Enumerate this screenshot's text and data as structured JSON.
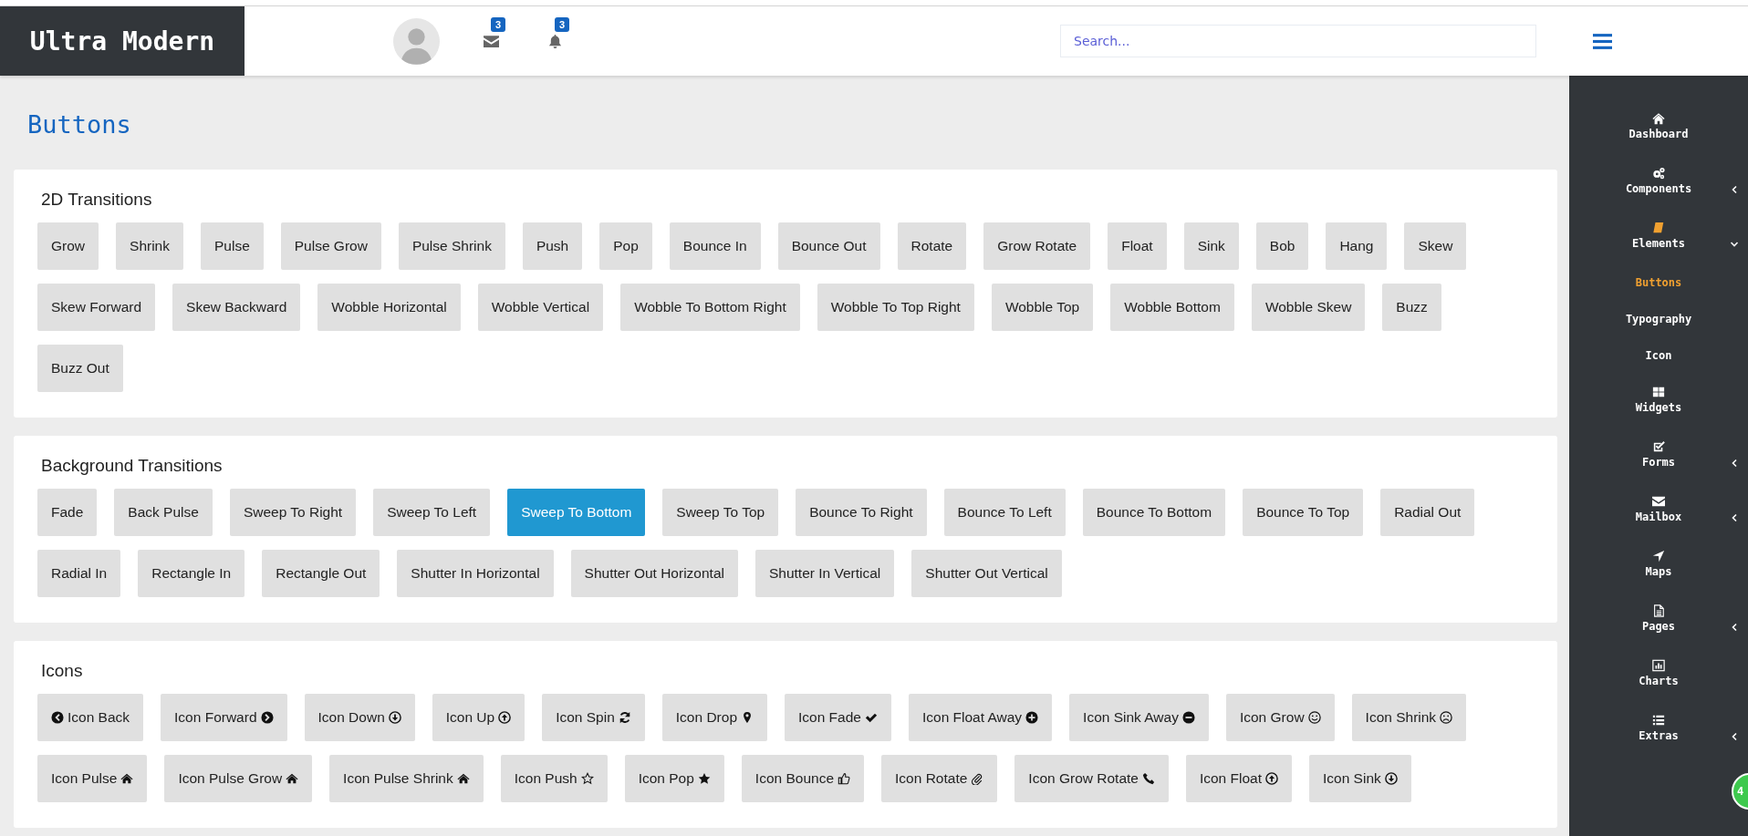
{
  "header": {
    "logo": "Ultra Modern",
    "messages_badge": "3",
    "notifications_badge": "3",
    "search": {
      "placeholder": "Search..."
    }
  },
  "page_title": "Buttons",
  "sections": [
    {
      "title": "2D Transitions",
      "buttons": [
        {
          "label": "Grow",
          "selected": false
        },
        {
          "label": "Shrink",
          "selected": false
        },
        {
          "label": "Pulse",
          "selected": false
        },
        {
          "label": "Pulse Grow",
          "selected": false
        },
        {
          "label": "Pulse Shrink",
          "selected": false
        },
        {
          "label": "Push",
          "selected": false
        },
        {
          "label": "Pop",
          "selected": false
        },
        {
          "label": "Bounce In",
          "selected": false
        },
        {
          "label": "Bounce Out",
          "selected": false
        },
        {
          "label": "Rotate",
          "selected": false
        },
        {
          "label": "Grow Rotate",
          "selected": false
        },
        {
          "label": "Float",
          "selected": false
        },
        {
          "label": "Sink",
          "selected": false
        },
        {
          "label": "Bob",
          "selected": false
        },
        {
          "label": "Hang",
          "selected": false
        },
        {
          "label": "Skew",
          "selected": false
        },
        {
          "label": "Skew Forward",
          "selected": false
        },
        {
          "label": "Skew Backward",
          "selected": false
        },
        {
          "label": "Wobble Horizontal",
          "selected": false
        },
        {
          "label": "Wobble Vertical",
          "selected": false
        },
        {
          "label": "Wobble To Bottom Right",
          "selected": false
        },
        {
          "label": "Wobble To Top Right",
          "selected": false
        },
        {
          "label": "Wobble Top",
          "selected": false
        },
        {
          "label": "Wobble Bottom",
          "selected": false
        },
        {
          "label": "Wobble Skew",
          "selected": false
        },
        {
          "label": "Buzz",
          "selected": false
        },
        {
          "label": "Buzz Out",
          "selected": false
        }
      ]
    },
    {
      "title": "Background Transitions",
      "buttons": [
        {
          "label": "Fade",
          "selected": false
        },
        {
          "label": "Back Pulse",
          "selected": false
        },
        {
          "label": "Sweep To Right",
          "selected": false
        },
        {
          "label": "Sweep To Left",
          "selected": false
        },
        {
          "label": "Sweep To Bottom",
          "selected": true
        },
        {
          "label": "Sweep To Top",
          "selected": false
        },
        {
          "label": "Bounce To Right",
          "selected": false
        },
        {
          "label": "Bounce To Left",
          "selected": false
        },
        {
          "label": "Bounce To Bottom",
          "selected": false
        },
        {
          "label": "Bounce To Top",
          "selected": false
        },
        {
          "label": "Radial Out",
          "selected": false
        },
        {
          "label": "Radial In",
          "selected": false
        },
        {
          "label": "Rectangle In",
          "selected": false
        },
        {
          "label": "Rectangle Out",
          "selected": false
        },
        {
          "label": "Shutter In Horizontal",
          "selected": false
        },
        {
          "label": "Shutter Out Horizontal",
          "selected": false
        },
        {
          "label": "Shutter In Vertical",
          "selected": false
        },
        {
          "label": "Shutter Out Vertical",
          "selected": false
        }
      ]
    },
    {
      "title": "Icons",
      "buttons": [
        {
          "label": "Icon Back",
          "selected": false,
          "kind": "circle-left"
        },
        {
          "label": "Icon Forward",
          "selected": false,
          "kind": "circle-right"
        },
        {
          "label": "Icon Down",
          "selected": false,
          "kind": "circle-down"
        },
        {
          "label": "Icon Up",
          "selected": false,
          "kind": "circle-up"
        },
        {
          "label": "Icon Spin",
          "selected": false,
          "kind": "refresh"
        },
        {
          "label": "Icon Drop",
          "selected": false,
          "kind": "pin"
        },
        {
          "label": "Icon Fade",
          "selected": false,
          "kind": "check"
        },
        {
          "label": "Icon Float Away",
          "selected": false,
          "kind": "plus-circle"
        },
        {
          "label": "Icon Sink Away",
          "selected": false,
          "kind": "minus-circle"
        },
        {
          "label": "Icon Grow",
          "selected": false,
          "kind": "smile"
        },
        {
          "label": "Icon Shrink",
          "selected": false,
          "kind": "frown"
        },
        {
          "label": "Icon Pulse",
          "selected": false,
          "kind": "home"
        },
        {
          "label": "Icon Pulse Grow",
          "selected": false,
          "kind": "home"
        },
        {
          "label": "Icon Pulse Shrink",
          "selected": false,
          "kind": "home"
        },
        {
          "label": "Icon Push",
          "selected": false,
          "kind": "star-outline"
        },
        {
          "label": "Icon Pop",
          "selected": false,
          "kind": "star"
        },
        {
          "label": "Icon Bounce",
          "selected": false,
          "kind": "thumb"
        },
        {
          "label": "Icon Rotate",
          "selected": false,
          "kind": "paperclip"
        },
        {
          "label": "Icon Grow Rotate",
          "selected": false,
          "kind": "phone"
        },
        {
          "label": "Icon Float",
          "selected": false,
          "kind": "circle-up"
        },
        {
          "label": "Icon Sink",
          "selected": false,
          "kind": "circle-down"
        }
      ]
    }
  ],
  "sidebar": {
    "items": [
      {
        "label": "Dashboard",
        "kind": "home",
        "selected": false
      },
      {
        "label": "Components",
        "kind": "cogs",
        "selected": false,
        "expanded": false
      },
      {
        "label": "Elements",
        "kind": "book",
        "selected": true,
        "expanded": true,
        "children": [
          {
            "label": "Buttons",
            "selected": true
          },
          {
            "label": "Typography",
            "selected": false
          },
          {
            "label": "Icon",
            "selected": false
          }
        ]
      },
      {
        "label": "Widgets",
        "kind": "grid",
        "selected": false
      },
      {
        "label": "Forms",
        "kind": "check-square",
        "selected": false,
        "expanded": false
      },
      {
        "label": "Mailbox",
        "kind": "envelope",
        "selected": false,
        "expanded": false
      },
      {
        "label": "Maps",
        "kind": "arrow",
        "selected": false
      },
      {
        "label": "Pages",
        "kind": "file",
        "selected": false,
        "expanded": false
      },
      {
        "label": "Charts",
        "kind": "chart",
        "selected": false
      },
      {
        "label": "Extras",
        "kind": "list",
        "selected": false,
        "expanded": false
      }
    ]
  },
  "floating_badge": "4"
}
